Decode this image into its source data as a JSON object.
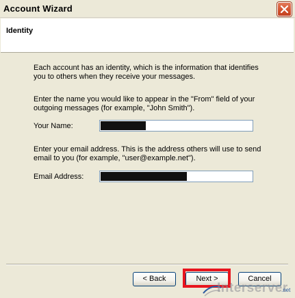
{
  "window": {
    "title": "Account Wizard"
  },
  "header": {
    "title": "Identity"
  },
  "intro": {
    "line1": "Each account has an identity, which is the information that identifies",
    "line2": "you to others when they receive your messages."
  },
  "name_section": {
    "line1": "Enter the name you would like to appear in the \"From\" field of your",
    "line2": "outgoing messages (for example, \"John Smith\").",
    "label": "Your Name:",
    "value_redacted": true
  },
  "email_section": {
    "line1": "Enter your email address. This is the address others will use to send",
    "line2": "email to you (for example, \"user@example.net\").",
    "label": "Email Address:",
    "value_redacted": true
  },
  "buttons": {
    "back": "< Back",
    "next": "Next >",
    "cancel": "Cancel"
  },
  "watermark": {
    "text": "Interserver",
    "suffix": ".net"
  },
  "colors": {
    "highlight": "#e8141e",
    "close_button": "#d3532f",
    "dialog_bg": "#ece9d8"
  },
  "icons": {
    "close": "close-icon"
  }
}
